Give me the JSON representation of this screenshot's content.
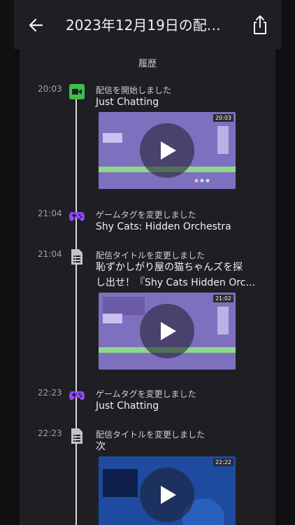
{
  "header": {
    "title": "2023年12月19日の配…"
  },
  "history": {
    "heading": "履歴"
  },
  "events": [
    {
      "time": "20:03",
      "label": "配信を開始しました",
      "value": "Just Chatting",
      "icon": "video-camera-icon",
      "thumb_duration": "20:03"
    },
    {
      "time": "21:04",
      "label": "ゲームタグを変更しました",
      "value": "Shy Cats: Hidden Orchestra",
      "icon": "gamepad-icon"
    },
    {
      "time": "21:04",
      "label": "配信タイトルを変更しました",
      "value_line1": "恥ずかしがり屋の猫ちゃんズを探",
      "value_line2": "し出せ！『Shy Cats Hidden Orc…",
      "icon": "document-icon",
      "thumb_duration": "21:02"
    },
    {
      "time": "22:23",
      "label": "ゲームタグを変更しました",
      "value": "Just Chatting",
      "icon": "gamepad-icon"
    },
    {
      "time": "22:23",
      "label": "配信タイトルを変更しました",
      "value": "次",
      "icon": "document-icon",
      "thumb_duration": "22:22"
    }
  ],
  "colors": {
    "camera": "#3bbf4a",
    "gamepad": "#9146ff",
    "doc": "#c4c4c8"
  }
}
